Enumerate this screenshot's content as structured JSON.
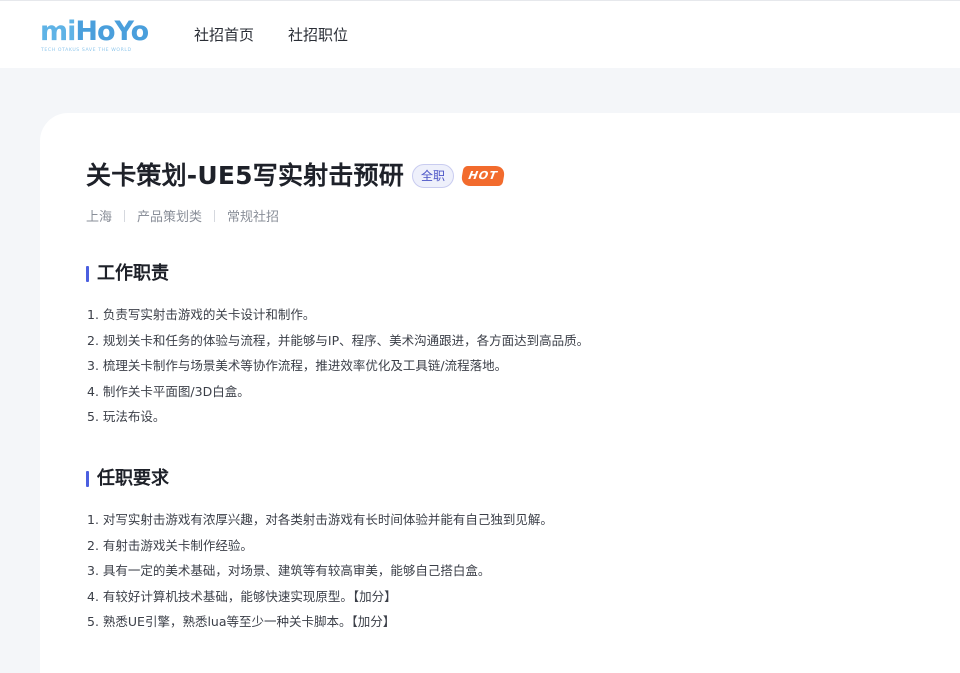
{
  "header": {
    "logo": {
      "word_left": "mi",
      "word_mid": "HoYo",
      "tagline": "TECH OTAKUS SAVE THE WORLD"
    },
    "nav": [
      {
        "label": "社招首页"
      },
      {
        "label": "社招职位"
      }
    ]
  },
  "job": {
    "title": "关卡策划-UE5写实射击预研",
    "type_badge": "全职",
    "hot_badge": "HOT",
    "meta": [
      "上海",
      "产品策划类",
      "常规社招"
    ]
  },
  "sections": {
    "duties": {
      "title": "工作职责",
      "items": [
        "1. 负责写实射击游戏的关卡设计和制作。",
        "2. 规划关卡和任务的体验与流程，并能够与IP、程序、美术沟通跟进，各方面达到高品质。",
        "3. 梳理关卡制作与场景美术等协作流程，推进效率优化及工具链/流程落地。",
        "4. 制作关卡平面图/3D白盒。",
        "5. 玩法布设。"
      ]
    },
    "requirements": {
      "title": "任职要求",
      "items": [
        "1. 对写实射击游戏有浓厚兴趣，对各类射击游戏有长时间体验并能有自己独到见解。",
        "2. 有射击游戏关卡制作经验。",
        "3. 具有一定的美术基础，对场景、建筑等有较高审美，能够自己搭白盒。",
        "4. 有较好计算机技术基础，能够快速实现原型。【加分】",
        "5. 熟悉UE引擎，熟悉lua等至少一种关卡脚本。【加分】"
      ]
    }
  },
  "colors": {
    "accent": "#4b5fe0",
    "hot": "#f26b2d",
    "logo": "#5fb3e6",
    "page_bg": "#f4f6f9"
  }
}
